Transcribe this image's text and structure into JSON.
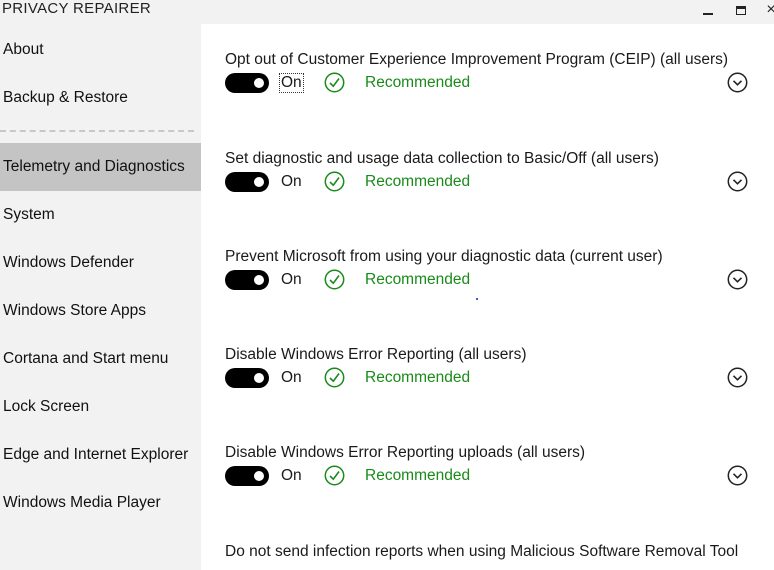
{
  "window": {
    "title": "PRIVACY REPAIRER",
    "minimize_icon": "minimize-icon",
    "maximize_icon": "maximize-icon",
    "close_icon": "close-icon",
    "close_glyph": "×"
  },
  "sidebar": {
    "items": [
      {
        "label": "About"
      },
      {
        "label": "Backup & Restore"
      },
      {
        "label": "Telemetry and Diagnostics",
        "active": true
      },
      {
        "label": "System"
      },
      {
        "label": "Windows Defender"
      },
      {
        "label": "Windows Store Apps"
      },
      {
        "label": "Cortana and Start menu"
      },
      {
        "label": "Lock Screen"
      },
      {
        "label": "Edge and Internet Explorer"
      },
      {
        "label": "Windows Media Player"
      }
    ]
  },
  "settings": [
    {
      "title": "Opt out of Customer Experience Improvement Program (CEIP) (all users)",
      "state": "On",
      "recommendation": "Recommended"
    },
    {
      "title": "Set diagnostic and usage data collection to Basic/Off (all users)",
      "state": "On",
      "recommendation": "Recommended"
    },
    {
      "title": "Prevent Microsoft from using your diagnostic data (current user)",
      "state": "On",
      "recommendation": "Recommended"
    },
    {
      "title": "Disable Windows Error Reporting (all users)",
      "state": "On",
      "recommendation": "Recommended"
    },
    {
      "title": "Disable Windows Error Reporting uploads (all users)",
      "state": "On",
      "recommendation": "Recommended"
    },
    {
      "title": "Do not send infection reports when using Malicious Software Removal Tool"
    }
  ],
  "colors": {
    "sidebar_bg": "#f2f2f2",
    "active_item_bg": "#c4c4c4",
    "recommended": "#1a8a1a",
    "toggle_on": "#000000"
  }
}
